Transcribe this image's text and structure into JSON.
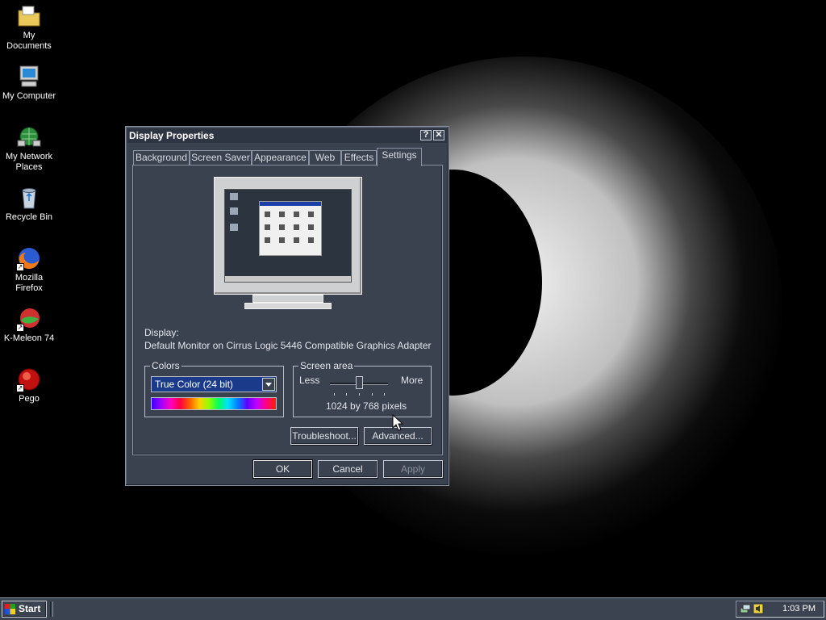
{
  "desktop": {
    "icons": [
      {
        "label": "My Documents"
      },
      {
        "label": "My Computer"
      },
      {
        "label": "My Network Places"
      },
      {
        "label": "Recycle Bin"
      },
      {
        "label": "Mozilla Firefox"
      },
      {
        "label": "K-Meleon 74"
      },
      {
        "label": "Pego"
      }
    ]
  },
  "dialog": {
    "title": "Display Properties",
    "help_button": "?",
    "close_button": "✕",
    "tabs": [
      {
        "label": "Background"
      },
      {
        "label": "Screen Saver"
      },
      {
        "label": "Appearance"
      },
      {
        "label": "Web"
      },
      {
        "label": "Effects"
      },
      {
        "label": "Settings",
        "active": true
      }
    ],
    "display_label": "Display:",
    "display_value": "Default Monitor on Cirrus Logic 5446 Compatible Graphics Adapter",
    "colors": {
      "legend": "Colors",
      "selected": "True Color (24 bit)"
    },
    "screen_area": {
      "legend": "Screen area",
      "less_label": "Less",
      "more_label": "More",
      "resolution": "1024 by 768 pixels"
    },
    "buttons": {
      "troubleshoot": "Troubleshoot...",
      "advanced": "Advanced...",
      "ok": "OK",
      "cancel": "Cancel",
      "apply": "Apply"
    }
  },
  "taskbar": {
    "start_label": "Start",
    "clock": "1:03 PM"
  }
}
